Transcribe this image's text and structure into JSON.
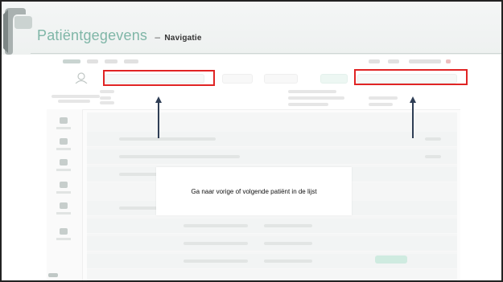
{
  "slide": {
    "title": "Patiëntgegevens",
    "separator": "–",
    "subtitle": "Navigatie"
  },
  "callout": {
    "text": "Ga naar vorige of volgende patiënt in de lijst"
  },
  "colors": {
    "title_teal": "#7fb6a7",
    "annotation_red": "#e02424",
    "arrow_navy": "#2f3e55"
  },
  "icons": {
    "logo": "logo-mark-icon",
    "arrow": "arrow-up-icon"
  }
}
